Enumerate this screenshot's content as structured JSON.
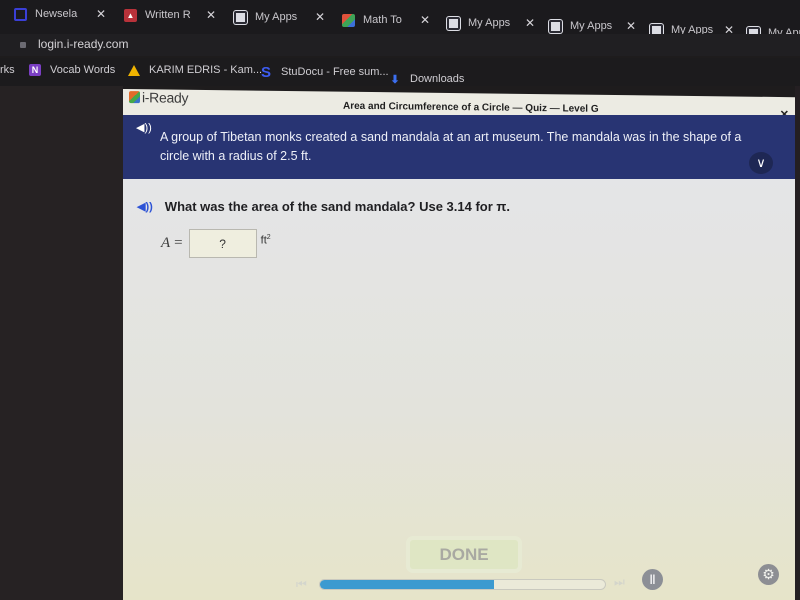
{
  "browser": {
    "tabs": [
      {
        "label": "Newsela",
        "icon": "newsela-icon"
      },
      {
        "label": "Written R",
        "icon": "written-icon"
      },
      {
        "label": "My Apps",
        "icon": "my-apps-icon"
      },
      {
        "label": "Math To",
        "icon": "math-icon"
      },
      {
        "label": "My Apps",
        "icon": "my-apps-icon"
      },
      {
        "label": "My Apps",
        "icon": "my-apps-icon"
      },
      {
        "label": "My Apps",
        "icon": "my-apps-icon"
      },
      {
        "label": "My Apps",
        "icon": "my-apps-icon"
      }
    ],
    "close_glyph": "✕",
    "url": "login.i-ready.com",
    "bookmarks": [
      {
        "label": "rks"
      },
      {
        "label": "Vocab Words",
        "icon_text": "N"
      },
      {
        "label": "KARIM EDRIS - Kam..."
      },
      {
        "label": "StuDocu - Free sum...",
        "icon_text": "S"
      },
      {
        "label": "Downloads",
        "icon_text": "⬇"
      }
    ]
  },
  "app": {
    "logo": "i-Ready",
    "title": "Area and Circumference of a Circle — Quiz — Level G",
    "close_glyph": "✕",
    "passage": "A group of Tibetan monks created a sand mandala at an art museum. The mandala was in the shape of a circle with a radius of 2.5 ft.",
    "speaker_glyph": "◀))",
    "expand_glyph": "∨",
    "question": "What was the area of the sand mandala? Use 3.14 for π.",
    "answer": {
      "variable": "A",
      "equals": "=",
      "placeholder": "?",
      "unit": "ft",
      "unit_exponent": "2"
    },
    "done_label": "DONE",
    "progress_fraction": 0.61,
    "prev_glyph": "⏮",
    "next_glyph": "⏭",
    "pause_glyph": "||",
    "gear_glyph": "⚙"
  }
}
